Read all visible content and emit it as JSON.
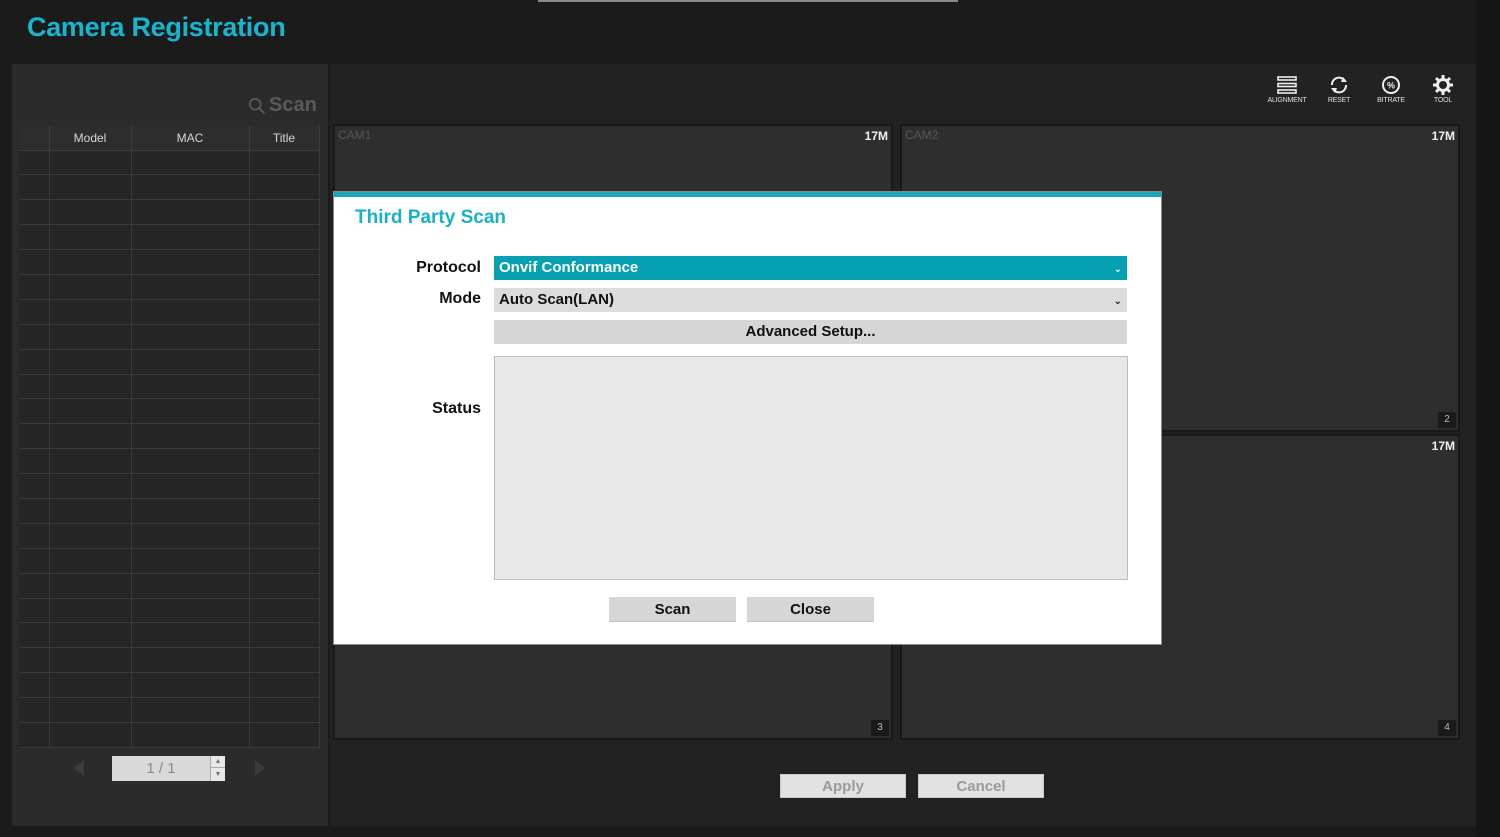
{
  "app": {
    "title": "Camera Registration"
  },
  "left_panel": {
    "scan_label": "Scan",
    "columns": [
      "",
      "Model",
      "MAC",
      "Title"
    ],
    "row_count": 24,
    "pager": {
      "text": "1 / 1"
    }
  },
  "toolbar": {
    "items": [
      {
        "label": "ALIGNMENT",
        "icon": "alignment-icon"
      },
      {
        "label": "RESET",
        "icon": "reset-icon"
      },
      {
        "label": "BITRATE",
        "icon": "bitrate-icon"
      },
      {
        "label": "TOOL",
        "icon": "gear-icon"
      }
    ]
  },
  "cameras": [
    {
      "label": "CAM1",
      "resolution": "17M",
      "number": ""
    },
    {
      "label": "CAM2",
      "resolution": "17M",
      "number": "2"
    },
    {
      "label": "",
      "resolution": "",
      "number": "3"
    },
    {
      "label": "",
      "resolution": "17M",
      "number": "4"
    }
  ],
  "bottom_buttons": {
    "apply": "Apply",
    "cancel": "Cancel"
  },
  "dialog": {
    "title": "Third Party Scan",
    "protocol_label": "Protocol",
    "protocol_value": "Onvif Conformance",
    "mode_label": "Mode",
    "mode_value": "Auto Scan(LAN)",
    "advanced_label": "Advanced Setup...",
    "status_label": "Status",
    "status_text": "",
    "scan_button": "Scan",
    "close_button": "Close"
  },
  "colors": {
    "accent": "#16b6cf",
    "dialog_border": "#18a7ba",
    "selected_field": "#05a0b1"
  }
}
